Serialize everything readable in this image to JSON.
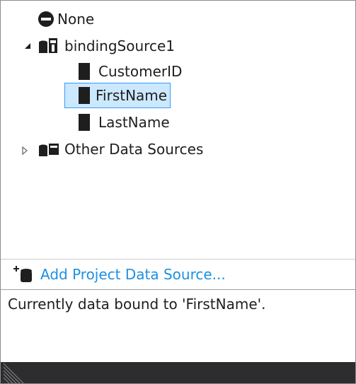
{
  "tree": {
    "none_label": "None",
    "binding_source": {
      "label": "bindingSource1",
      "children": [
        {
          "label": "CustomerID"
        },
        {
          "label": "FirstName"
        },
        {
          "label": "LastName"
        }
      ]
    },
    "other_label": "Other Data Sources"
  },
  "footer": {
    "add_label": "Add Project Data Source..."
  },
  "status": {
    "text": "Currently data bound to 'FirstName'."
  },
  "colors": {
    "link": "#1e90e0",
    "selection_bg": "#cce8ff",
    "selection_border": "#3399ff",
    "bottom_bar": "#2d2d30"
  },
  "icons": {
    "none": "no-entry-icon",
    "binding_source": "binding-source-icon",
    "field": "field-icon",
    "other_sources": "data-sources-icon",
    "add": "add-data-source-icon"
  }
}
